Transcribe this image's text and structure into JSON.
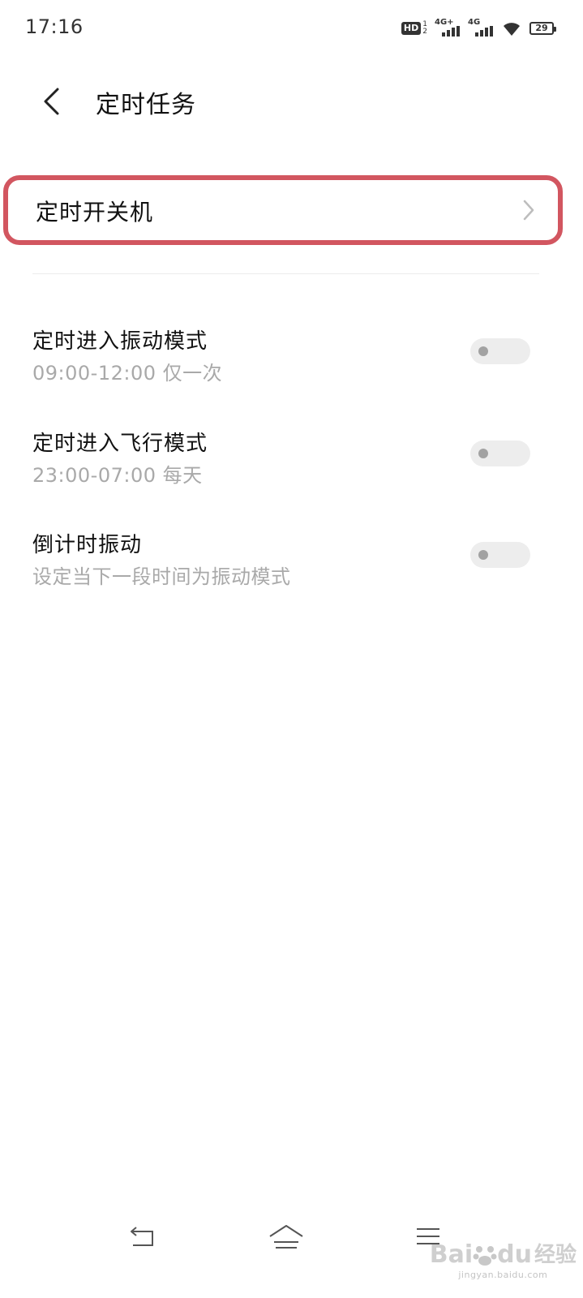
{
  "status_bar": {
    "time": "17:16",
    "hd_label": "HD",
    "hd_sub_top": "1",
    "hd_sub_bottom": "2",
    "network1": "4G+",
    "network2": "4G",
    "battery": "29"
  },
  "header": {
    "title": "定时任务",
    "back_icon": "chevron-left-icon"
  },
  "card": {
    "label": "定时开关机",
    "chevron_icon": "chevron-right-icon",
    "highlight_color": "#d25660"
  },
  "settings": [
    {
      "title": "定时进入振动模式",
      "subtitle": "09:00-12:00 仅一次",
      "enabled": false
    },
    {
      "title": "定时进入飞行模式",
      "subtitle": "23:00-07:00 每天",
      "enabled": false
    },
    {
      "title": "倒计时振动",
      "subtitle": "设定当下一段时间为振动模式",
      "enabled": false
    }
  ],
  "nav": {
    "back_icon": "nav-back-icon",
    "home_icon": "nav-home-icon",
    "menu_icon": "nav-menu-icon"
  },
  "watermark": {
    "brand_left": "Bai",
    "brand_right": "du",
    "brand_cn": "经验",
    "url": "jingyan.baidu.com"
  },
  "colors": {
    "subtitle_gray": "#a9a9a9",
    "toggle_track": "#ededed",
    "toggle_knob": "#a2a2a2"
  }
}
